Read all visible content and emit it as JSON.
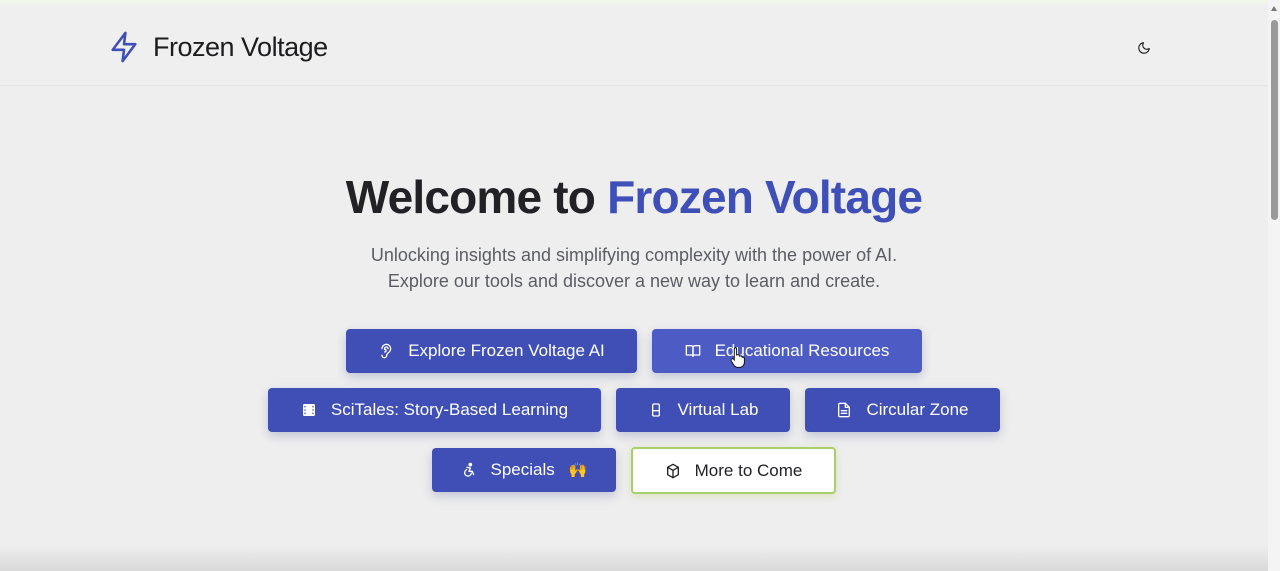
{
  "header": {
    "brand": "Frozen Voltage",
    "logo_icon": "lightning-bolt-icon",
    "theme_toggle_icon": "moon-icon"
  },
  "hero": {
    "title_prefix": "Welcome to ",
    "title_accent": "Frozen Voltage",
    "subtitle_line1": "Unlocking insights and simplifying complexity with the power of AI.",
    "subtitle_line2": "Explore our tools and discover a new way to learn and create."
  },
  "buttons": [
    {
      "label": "Explore Frozen Voltage AI",
      "icon": "ear-icon"
    },
    {
      "label": "Educational Resources",
      "icon": "book-open-icon"
    },
    {
      "label": "SciTales: Story-Based Learning",
      "icon": "film-icon"
    },
    {
      "label": "Virtual Lab",
      "icon": "test-tube-icon"
    },
    {
      "label": "Circular Zone",
      "icon": "document-icon"
    },
    {
      "label": "Specials",
      "emoji": "🙌",
      "icon": "accessibility-icon"
    },
    {
      "label": "More to Come",
      "icon": "package-icon"
    }
  ],
  "colors": {
    "accent": "#3f4fb8",
    "button": "#3f4fb6",
    "outline_border": "#a7cf6e",
    "background": "#eeeeee"
  }
}
